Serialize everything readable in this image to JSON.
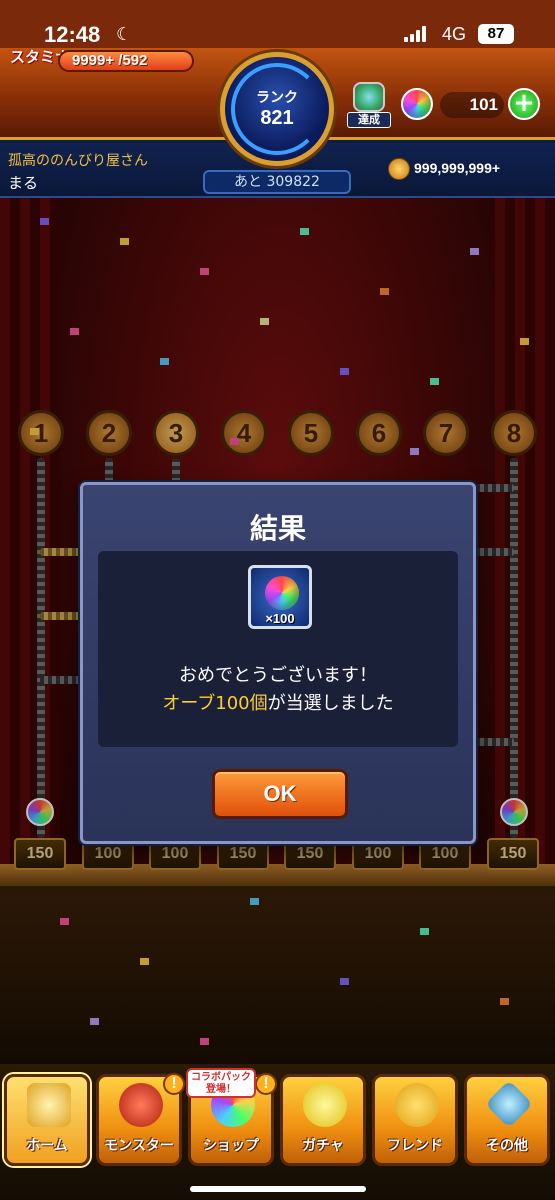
{
  "status_bar": {
    "time": "12:48",
    "network": "4G",
    "battery": "87"
  },
  "header": {
    "stamina_label": "スタミナ",
    "stamina_value": "9999+ /592",
    "rank_label": "ランク",
    "rank_value": "821",
    "rank_remaining": "あと 309822",
    "achievement_label": "達成",
    "orb_count": "101",
    "plus_label": "+",
    "player_title": "孤高ののんびり屋さん",
    "player_name": "まる",
    "coins": "999,999,999+"
  },
  "game": {
    "slots": [
      "1",
      "2",
      "3",
      "4",
      "5",
      "6",
      "7",
      "8"
    ],
    "prizes": [
      "150",
      "100",
      "100",
      "150",
      "150",
      "100",
      "100",
      "150"
    ]
  },
  "dialog": {
    "title": "結果",
    "reward_qty": "×100",
    "message_line1": "おめでとうございます！",
    "message_highlight": "オーブ100個",
    "message_rest": "が当選しました",
    "ok_label": "OK"
  },
  "bottom_nav": {
    "items": [
      {
        "label": "ホーム",
        "icon": "castle-icon"
      },
      {
        "label": "モンスター",
        "icon": "dragon-icon",
        "alert": "!"
      },
      {
        "label": "ショップ",
        "icon": "orb-icon",
        "alert": "!",
        "tag": "コラボパック登場！"
      },
      {
        "label": "ガチャ",
        "icon": "egg-icon"
      },
      {
        "label": "フレンド",
        "icon": "friends-icon"
      },
      {
        "label": "その他",
        "icon": "other-icon"
      }
    ]
  },
  "colors": {
    "header_orange": "#c35510",
    "accent_gold": "#d9a030",
    "dialog_bg": "#2a3358",
    "highlight_yellow": "#ffcc33",
    "ok_button": "#e0500a"
  }
}
